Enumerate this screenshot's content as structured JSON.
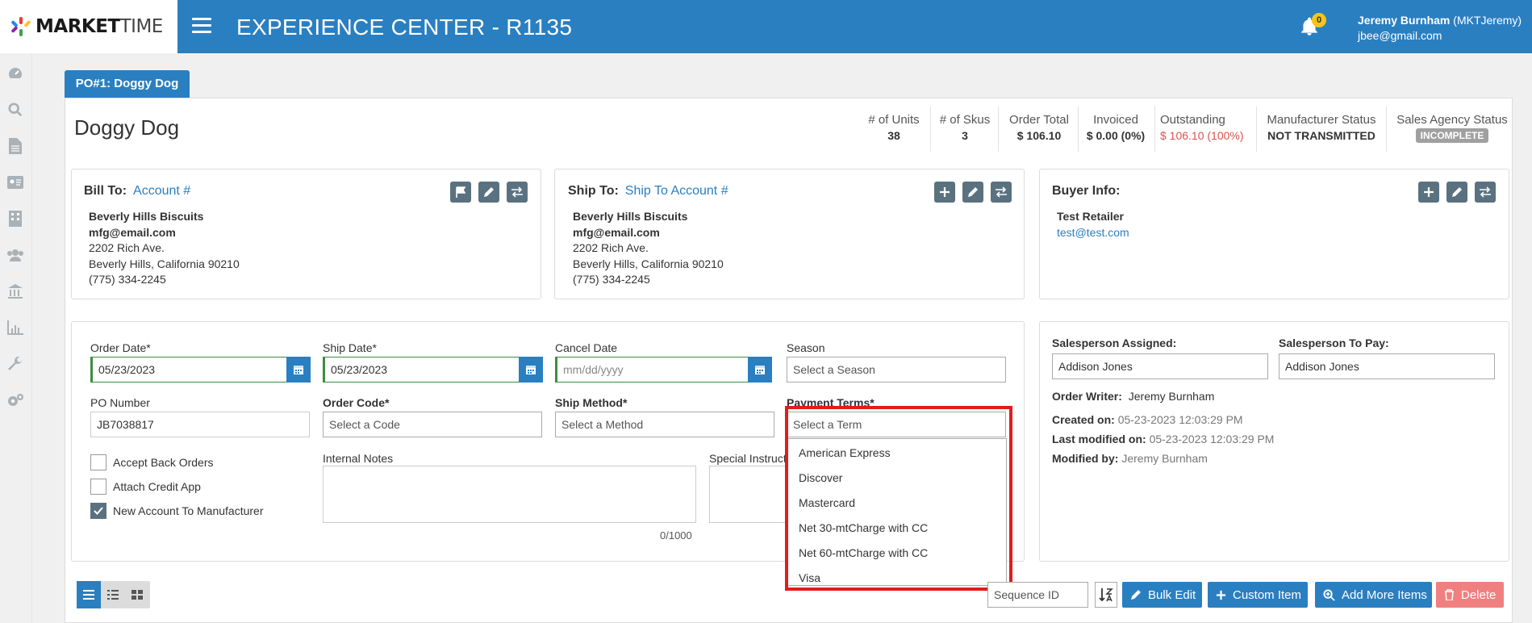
{
  "header": {
    "logo_strong": "MARKET",
    "logo_light": "TIME",
    "title": "EXPERIENCE CENTER - R1135",
    "notification_count": "0",
    "user_name": "Jeremy Burnham",
    "user_handle": "(MKTJeremy)",
    "user_email": "jbee@gmail.com"
  },
  "tab": {
    "label": "PO#1: Doggy Dog"
  },
  "order": {
    "name": "Doggy Dog"
  },
  "stats": [
    {
      "label": "# of Units",
      "value": "38"
    },
    {
      "label": "# of Skus",
      "value": "3"
    },
    {
      "label": "Order Total",
      "value": "$ 106.10"
    },
    {
      "label": "Invoiced",
      "value": "$ 0.00 (0%)"
    },
    {
      "label": "Outstanding",
      "value": "$ 106.10 (100%)"
    },
    {
      "label": "Manufacturer Status",
      "value": "NOT TRANSMITTED"
    },
    {
      "label": "Sales Agency Status",
      "value": "INCOMPLETE"
    }
  ],
  "bill_to": {
    "title": "Bill To:",
    "link": "Account #",
    "name": "Beverly Hills Biscuits",
    "email": "mfg@email.com",
    "street": "2202 Rich Ave.",
    "city": "Beverly Hills, California 90210",
    "phone": "(775) 334-2245"
  },
  "ship_to": {
    "title": "Ship To:",
    "link": "Ship To Account #",
    "name": "Beverly Hills Biscuits",
    "email": "mfg@email.com",
    "street": "2202 Rich Ave.",
    "city": "Beverly Hills, California 90210",
    "phone": "(775) 334-2245"
  },
  "buyer": {
    "title": "Buyer Info:",
    "name": "Test Retailer",
    "email": "test@test.com"
  },
  "form": {
    "order_date_label": "Order Date*",
    "order_date": "05/23/2023",
    "ship_date_label": "Ship Date*",
    "ship_date": "05/23/2023",
    "cancel_date_label": "Cancel Date",
    "cancel_date_placeholder": "mm/dd/yyyy",
    "season_label": "Season",
    "season_value": "Select a Season",
    "po_label": "PO Number",
    "po_value": "JB7038817",
    "order_code_label": "Order Code*",
    "order_code_value": "Select a Code",
    "ship_method_label": "Ship Method*",
    "ship_method_value": "Select a Method",
    "payment_terms_label": "Payment Terms*",
    "payment_terms_value": "Select a Term",
    "accept_back_orders": "Accept Back Orders",
    "attach_credit_app": "Attach Credit App",
    "new_account": "New Account To Manufacturer",
    "internal_notes_label": "Internal Notes",
    "special_instructions_label": "Special Instructions",
    "notes_counter": "0/1000"
  },
  "payment_terms_options": [
    "American Express",
    "Discover",
    "Mastercard",
    "Net 30-mtCharge with CC",
    "Net 60-mtCharge with CC",
    "Visa"
  ],
  "sales": {
    "assigned_label": "Salesperson Assigned:",
    "assigned_value": "Addison Jones",
    "to_pay_label": "Salesperson To Pay:",
    "to_pay_value": "Addison Jones",
    "writer_label": "Order Writer:",
    "writer_value": "Jeremy Burnham",
    "created_label": "Created on:",
    "created_value": "05-23-2023 12:03:29 PM",
    "modified_label": "Last modified on:",
    "modified_value": "05-23-2023 12:03:29 PM",
    "modified_by_label": "Modified by:",
    "modified_by_value": "Jeremy Burnham"
  },
  "toolbar": {
    "sort_value": "Sequence ID",
    "bulk_edit": "Bulk Edit",
    "custom_item": "Custom Item",
    "add_more_items": "Add More Items",
    "delete": "Delete"
  },
  "colors": {
    "brand_blue": "#2a7fc1",
    "highlight_red": "#e41b1b",
    "outstanding_red": "#d9534f",
    "date_green": "#3c8d40"
  }
}
